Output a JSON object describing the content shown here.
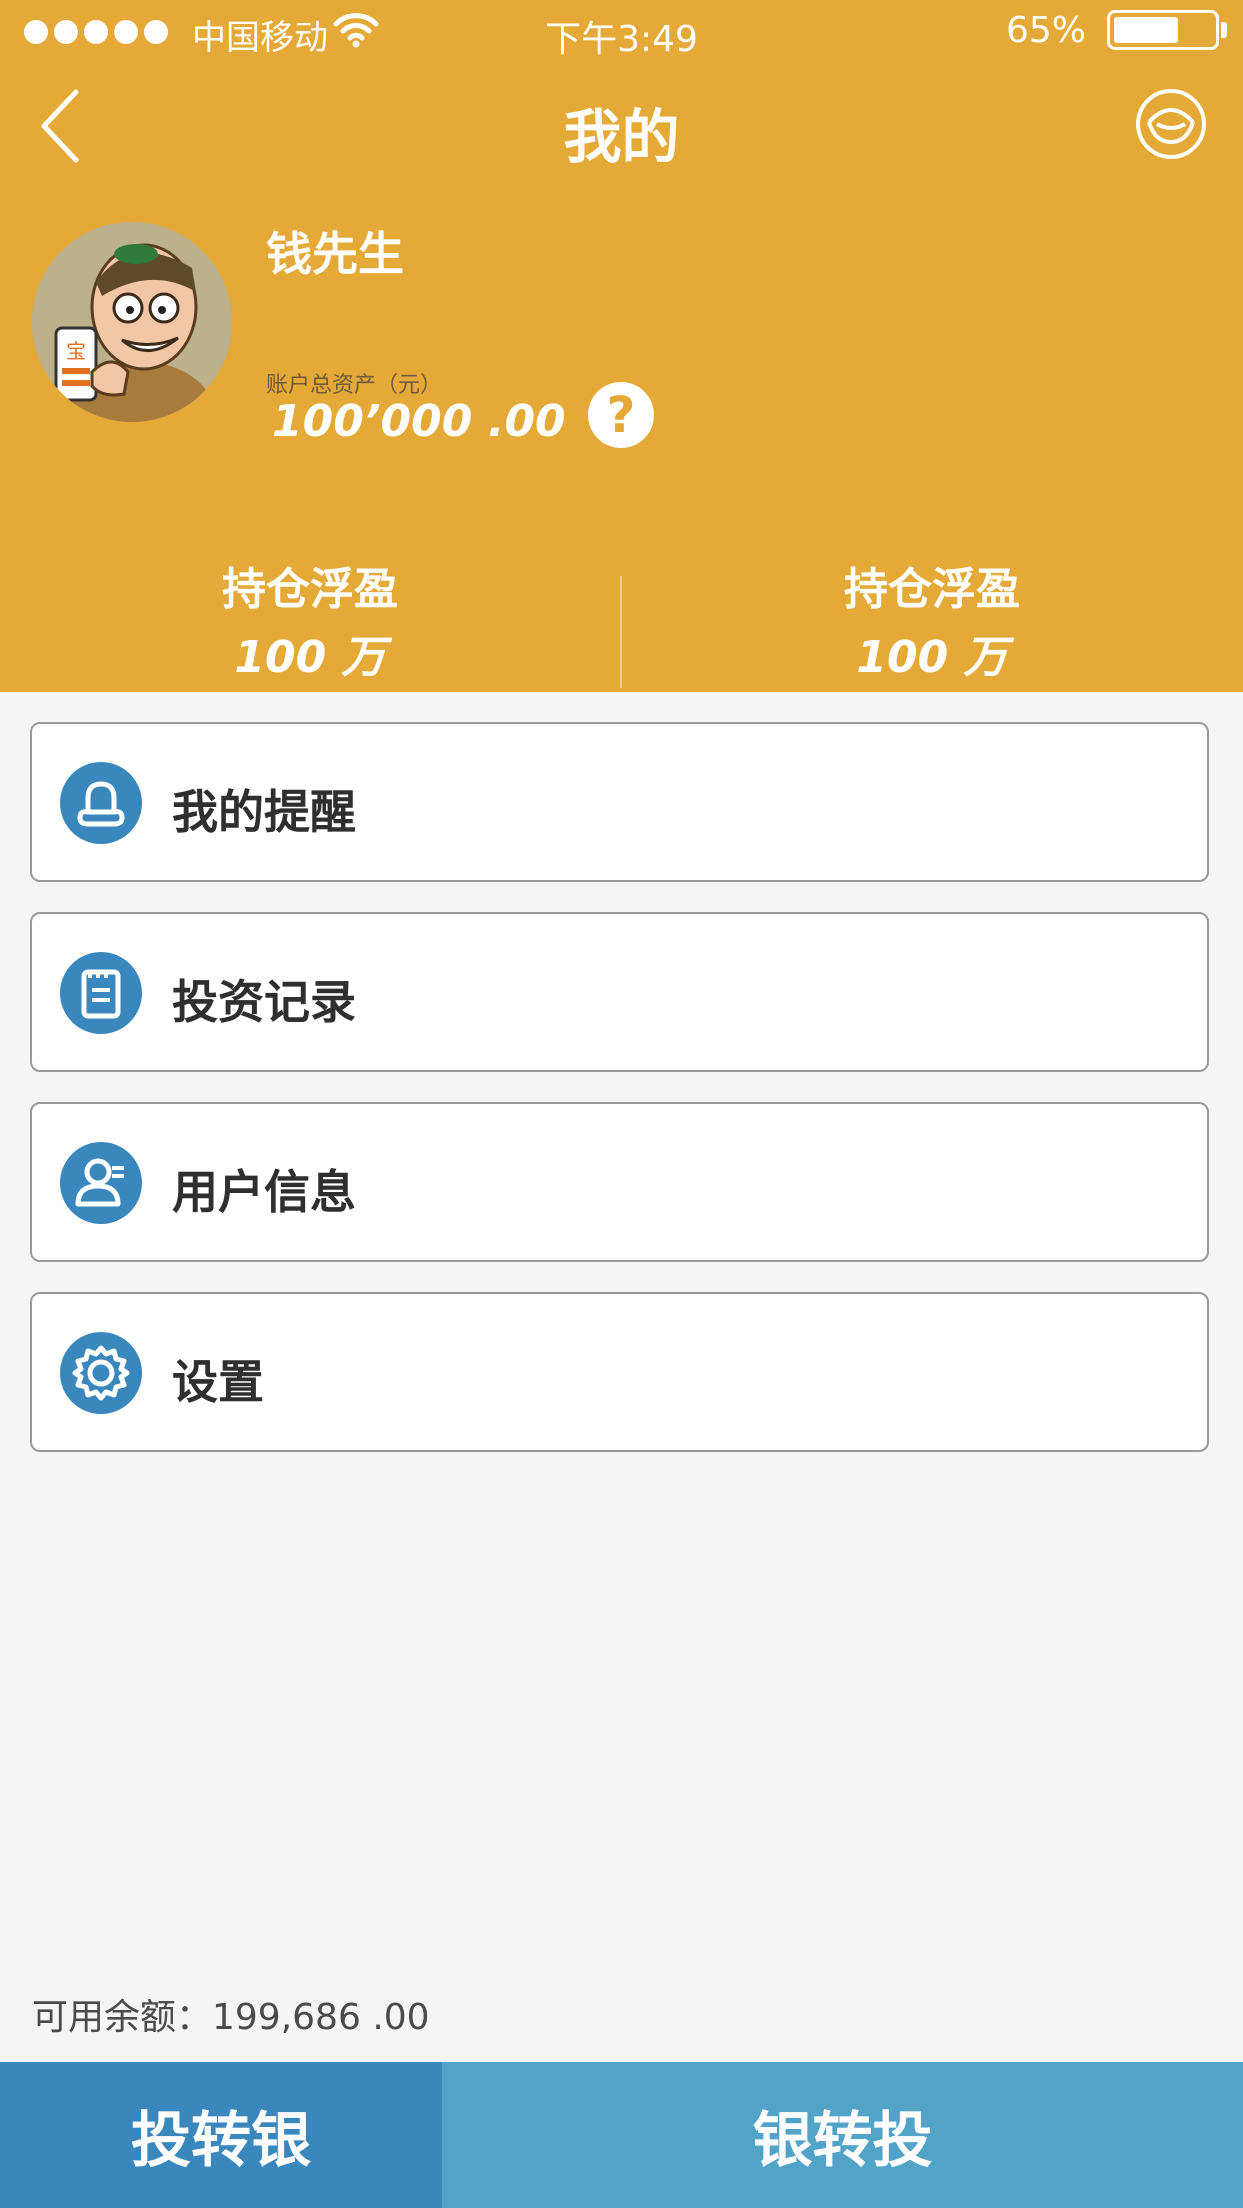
{
  "status_bar": {
    "carrier": "中国移动",
    "time": "下午3:49",
    "battery_percent": "65%",
    "battery_level": 0.65
  },
  "nav": {
    "title": "我的",
    "back_icon": "chevron-left-icon",
    "message_icon": "ingot-icon"
  },
  "profile": {
    "name": "钱先生",
    "assets_label": "账户总资产（元）",
    "assets_value": "100’000 .00",
    "help_symbol": "?",
    "avatar_badge": "宝"
  },
  "stats": [
    {
      "label": "持仓浮盈",
      "value": "100 万"
    },
    {
      "label": "持仓浮盈",
      "value": "100 万"
    }
  ],
  "menu": [
    {
      "label": "我的提醒",
      "icon": "bell-icon"
    },
    {
      "label": "投资记录",
      "icon": "record-icon"
    },
    {
      "label": "用户信息",
      "icon": "user-icon"
    },
    {
      "label": "设置",
      "icon": "gear-icon"
    }
  ],
  "balance": "可用余额：199,686 .00",
  "buttons": {
    "left": "投转银",
    "right": "银转投"
  },
  "colors": {
    "header": "#e5a938",
    "menu_icon": "#3a87be",
    "button_left": "#3a87be",
    "button_right": "#51a3c8"
  }
}
